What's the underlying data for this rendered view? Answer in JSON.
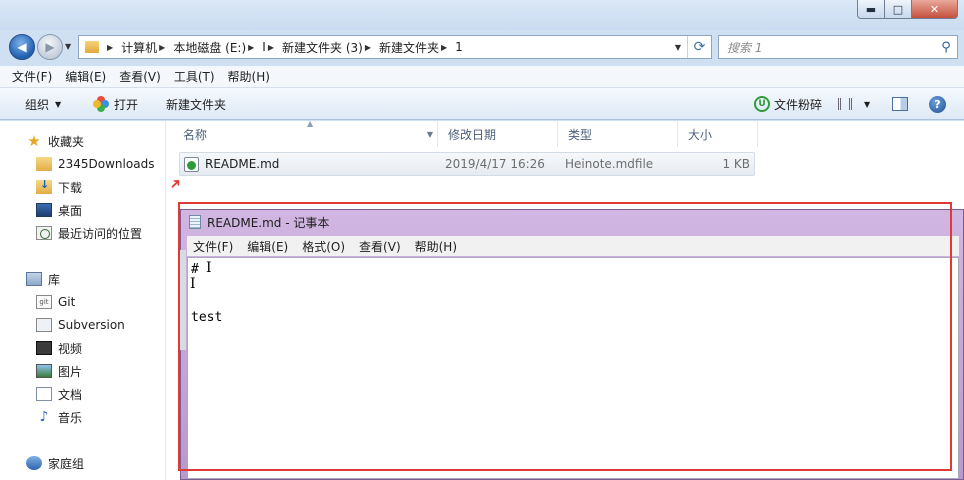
{
  "title_bar": {
    "ghost_text": "..."
  },
  "nav": {
    "breadcrumb": [
      "计算机",
      "本地磁盘 (E:)",
      "I",
      "新建文件夹 (3)",
      "新建文件夹",
      "1"
    ],
    "search_placeholder": "搜索 1"
  },
  "menu": [
    "文件(F)",
    "编辑(E)",
    "查看(V)",
    "工具(T)",
    "帮助(H)"
  ],
  "toolbar": {
    "organize": "组织",
    "open": "打开",
    "new_folder": "新建文件夹",
    "smash": "文件粉碎"
  },
  "sidebar": {
    "favorites": "收藏夹",
    "fav_items": [
      "2345Downloads",
      "下载",
      "桌面",
      "最近访问的位置"
    ],
    "library": "库",
    "lib_items": [
      "Git",
      "Subversion",
      "视频",
      "图片",
      "文档",
      "音乐"
    ],
    "homegroup": "家庭组"
  },
  "columns": [
    "名称",
    "修改日期",
    "类型",
    "大小"
  ],
  "files": [
    {
      "name": "README.md",
      "date": "2019/4/17 16:26",
      "type": "Heinote.mdfile",
      "size": "1 KB"
    }
  ],
  "notepad": {
    "title": "README.md - 记事本",
    "menu": [
      "文件(F)",
      "编辑(E)",
      "格式(O)",
      "查看(V)",
      "帮助(H)"
    ],
    "lines": [
      "#",
      "",
      "",
      "test"
    ]
  }
}
